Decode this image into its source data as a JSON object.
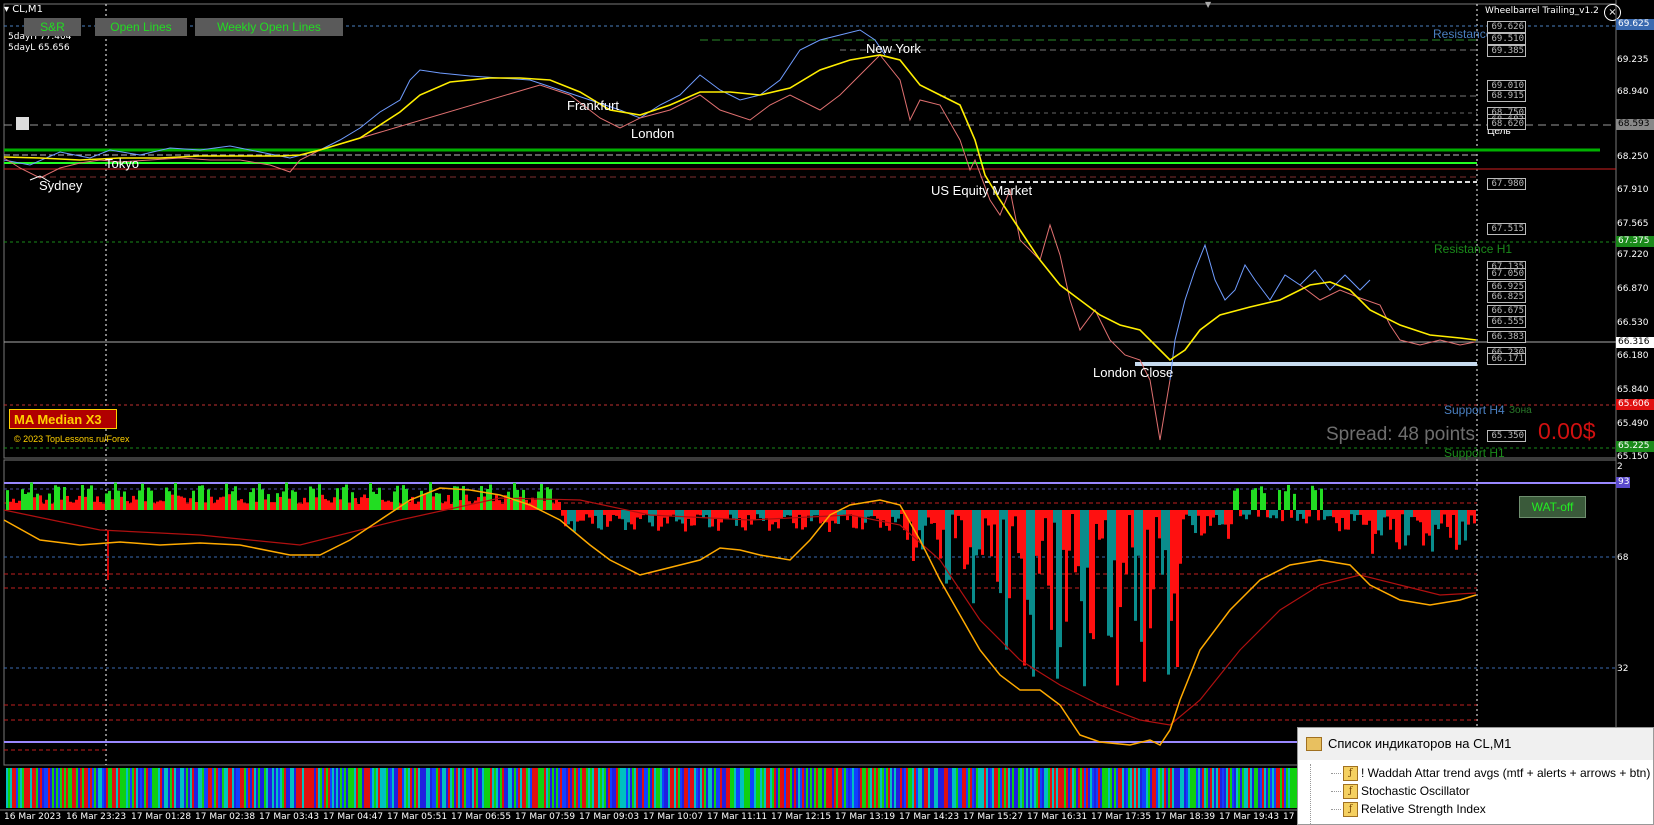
{
  "symbol": "CL,M1",
  "five_day_high": "5dayH 77.404",
  "five_day_low": "5dayL 65.656",
  "buttons": [
    "S&R",
    "Open Lines",
    "Weekly Open Lines"
  ],
  "ea": {
    "name": "Wheelbarrel Trailing_v1.2",
    "close_glyph": "×"
  },
  "sessions": [
    "Sydney",
    "Tokyo",
    "Frankfurt",
    "London",
    "New York",
    "US Equity Market",
    "London Close"
  ],
  "level_labels": {
    "resistance": "Resistance",
    "resistance_h1": "Resistance H1",
    "support_h4": "Support H4",
    "support_zone": "Зона",
    "support_h1": "Support H1",
    "target": "Цель"
  },
  "ma_title": "MA Median X3",
  "copyright": "© 2023 TopLessons.ru/Forex",
  "spread": "Spread: 48 points",
  "profit": "0.00$",
  "wat_button": "WAT-off",
  "price_labels": [
    "69.626",
    "69.510",
    "69.385",
    "69.010",
    "68.915",
    "68.750",
    "68.683",
    "68.620",
    "67.980",
    "67.515",
    "67.135",
    "67.050",
    "66.925",
    "66.825",
    "66.675",
    "66.555",
    "66.383",
    "66.230",
    "66.171",
    "65.350"
  ],
  "price_axis": [
    "69.625",
    "69.235",
    "68.940",
    "68.593",
    "68.250",
    "67.910",
    "67.565",
    "67.375",
    "67.220",
    "66.870",
    "66.530",
    "66.316",
    "66.180",
    "65.840",
    "65.606",
    "65.490",
    "65.225",
    "65.150"
  ],
  "osc_axis": [
    "2",
    "93",
    "68",
    "32"
  ],
  "time_axis": [
    "16 Mar 2023",
    "16 Mar 23:23",
    "17 Mar 01:28",
    "17 Mar 02:38",
    "17 Mar 03:43",
    "17 Mar 04:47",
    "17 Mar 05:51",
    "17 Mar 06:55",
    "17 Mar 07:59",
    "17 Mar 09:03",
    "17 Mar 10:07",
    "17 Mar 11:11",
    "17 Mar 12:15",
    "17 Mar 13:19",
    "17 Mar 14:23",
    "17 Mar 15:27",
    "17 Mar 16:31",
    "17 Mar 17:35",
    "17 Mar 18:39",
    "17 Mar 19:43",
    "17"
  ],
  "indicator_window": {
    "title": "Список индикаторов на CL,M1",
    "items": [
      "! Waddah Attar trend avgs (mtf + alerts + arrows + btn)",
      "Stochastic Oscillator",
      "Relative Strength Index"
    ]
  },
  "colors": {
    "background": "#000000",
    "bull_price": "#6f9cff",
    "bear_price": "#e07070",
    "ma_line": "#ffee00",
    "hist_up": "#22dd22",
    "hist_down": "#ff1010",
    "hist_teal": "#0a8c8c",
    "stoch_main": "#ffaa00",
    "stoch_signal": "#b01010",
    "level_purple": "#9a88ff"
  }
}
